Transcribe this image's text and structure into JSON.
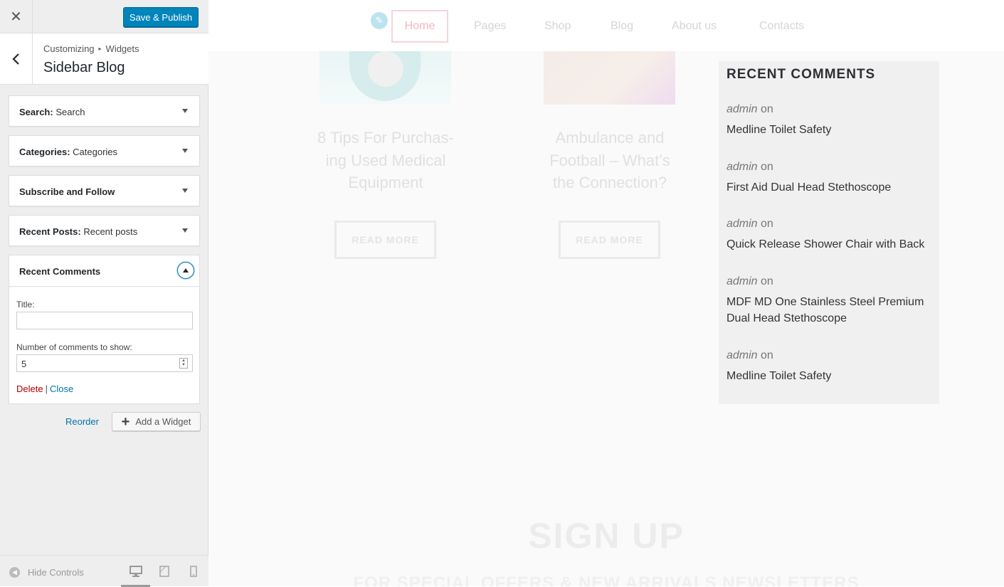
{
  "customizer": {
    "close_glyph": "✕",
    "save_label": "Save & Publish",
    "breadcrumb": [
      "Customizing",
      "Widgets"
    ],
    "breadcrumb_sep": "▸",
    "section_title": "Sidebar Blog",
    "widgets": [
      {
        "name": "Search",
        "instance": "Search"
      },
      {
        "name": "Categories",
        "instance": "Categories"
      },
      {
        "name": "Subscribe and Follow",
        "instance": ""
      },
      {
        "name": "Recent Posts",
        "instance": "Recent posts"
      }
    ],
    "open_widget": {
      "name": "Recent Comments",
      "title_label": "Title:",
      "title_value": "",
      "count_label": "Number of comments to show:",
      "count_value": "5",
      "delete_label": "Delete",
      "separator": "|",
      "close_label": "Close"
    },
    "reorder_label": "Reorder",
    "add_widget_label": "Add a Widget",
    "hide_controls_label": "Hide Controls",
    "devices": [
      "desktop-icon",
      "tablet-icon",
      "mobile-icon"
    ],
    "colors": {
      "primary": "#0085ba",
      "link": "#0073aa",
      "delete": "#aa0000"
    }
  },
  "preview": {
    "nav": [
      "Home",
      "Pages",
      "Shop",
      "Blog",
      "About us",
      "Contacts"
    ],
    "posts": [
      {
        "title": "8 Tips For Purchas-ing Used Medical Equipment",
        "lines": [
          "8 Tips For Purchas-",
          "ing Used Medical",
          "Equipment"
        ],
        "button": "READ MORE"
      },
      {
        "title": "Ambulance and Football – What’s the Connection?",
        "lines": [
          "Ambulance and",
          "Football – What’s",
          "the Connection?"
        ],
        "button": "READ MORE"
      }
    ],
    "recent_comments": {
      "title": "RECENT COMMENTS",
      "items": [
        {
          "author": "admin",
          "on": "on",
          "post": "Medline Toilet Safety"
        },
        {
          "author": "admin",
          "on": "on",
          "post": "First Aid Dual Head Stethoscope"
        },
        {
          "author": "admin",
          "on": "on",
          "post": "Quick Release Shower Chair with Back"
        },
        {
          "author": "admin",
          "on": "on",
          "post": "MDF MD One Stainless Steel Premium Dual Head Stethoscope"
        },
        {
          "author": "admin",
          "on": "on",
          "post": "Medline Toilet Safety"
        }
      ]
    },
    "signup_title": "SIGN UP",
    "signup_sub": "FOR SPECIAL OFFERS & NEW ARRIVALS NEWSLETTERS"
  }
}
